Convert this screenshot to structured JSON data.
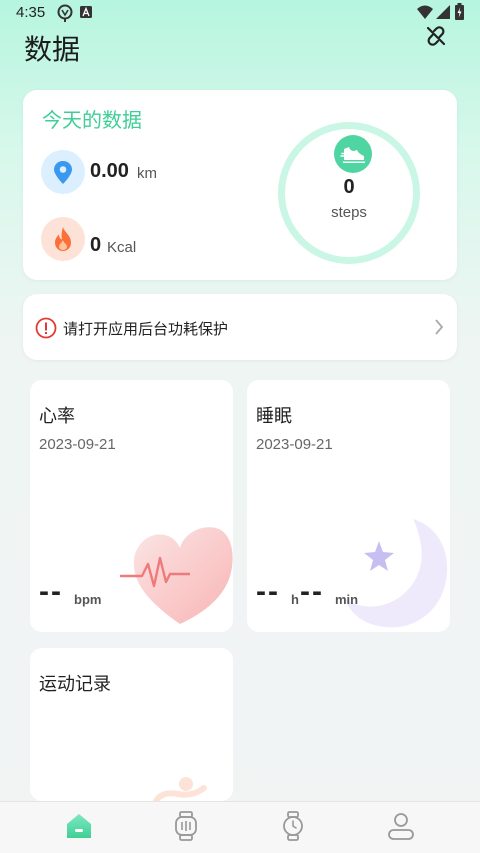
{
  "status_bar": {
    "time": "4:35"
  },
  "header": {
    "title": "数据"
  },
  "today": {
    "title": "今天的数据",
    "distance": {
      "value": "0.00",
      "unit": "km"
    },
    "calories": {
      "value": "0",
      "unit": "Kcal"
    },
    "steps": {
      "value": "0",
      "unit": "steps"
    }
  },
  "alert": {
    "text": "请打开应用后台功耗保护"
  },
  "heart_rate": {
    "title": "心率",
    "date": "2023-09-21",
    "value": "--",
    "unit": "bpm"
  },
  "sleep": {
    "title": "睡眠",
    "date": "2023-09-21",
    "hours": "--",
    "hours_unit": "h",
    "minutes": "--",
    "minutes_unit": "min"
  },
  "exercise": {
    "title": "运动记录"
  },
  "colors": {
    "accent": "#3fcf96",
    "ring": "#c9f6e5",
    "alert": "#e53935"
  },
  "bottom_nav": {
    "items": [
      {
        "icon": "home-icon",
        "active": true
      },
      {
        "icon": "watch-face-icon",
        "active": false
      },
      {
        "icon": "watch-icon",
        "active": false
      },
      {
        "icon": "profile-icon",
        "active": false
      }
    ]
  }
}
